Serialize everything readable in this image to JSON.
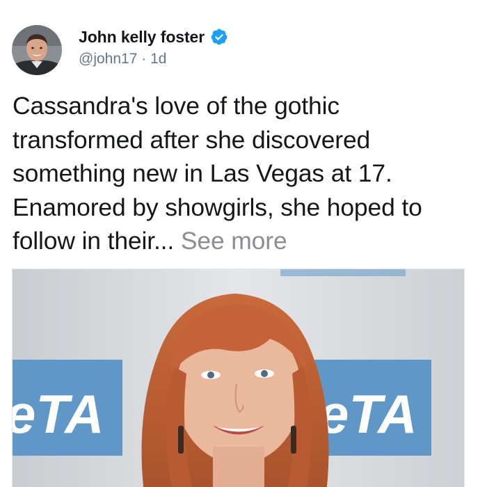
{
  "post": {
    "author": {
      "name": "John kelly foster",
      "handle": "@john17",
      "separator": "·",
      "time": "1d"
    },
    "text_lines": [
      "Cassandra's love of the gothic",
      "transformed after she discovered",
      "something new in Las Vegas at 17.",
      "Enamored by showgirls, she hoped to",
      "follow in their... "
    ],
    "see_more_label": "See more",
    "media": {
      "banner_text_left": "eTA",
      "banner_text_right": "eTA"
    }
  },
  "icons": {
    "verified": "verified-badge-icon"
  },
  "colors": {
    "verified_blue": "#1da1f2",
    "name_text": "#14171a",
    "secondary_text": "#657786",
    "see_more_text": "#8a8d91",
    "banner_blue": "#5f97c6"
  }
}
